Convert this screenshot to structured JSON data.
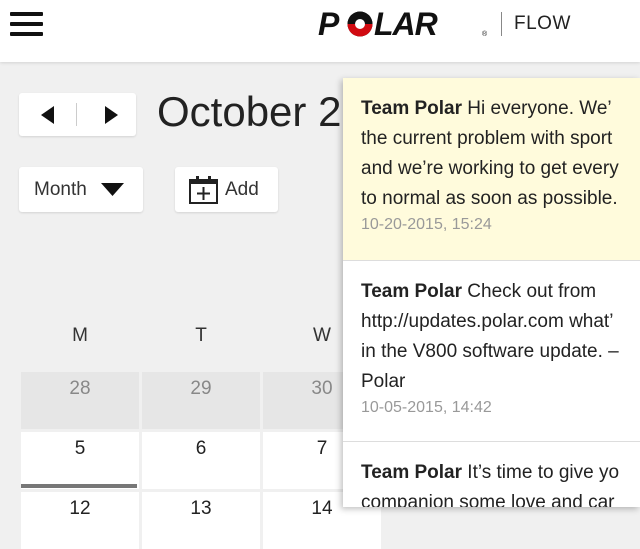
{
  "header": {
    "logo_text": "POLAR",
    "product": "FLOW"
  },
  "calendar": {
    "title": "October 2",
    "view_select": "Month",
    "add_label": "Add",
    "weekdays": [
      "M",
      "T",
      "W"
    ],
    "weeks": [
      [
        "28",
        "29",
        "30"
      ],
      [
        "5",
        "6",
        "7"
      ],
      [
        "12",
        "13",
        "14"
      ]
    ]
  },
  "notifications": [
    {
      "sender": "Team Polar",
      "lines": [
        " Hi everyone. We’",
        "the current problem with sport",
        "and we’re working to get every",
        "to normal as soon as possible."
      ],
      "time": "10-20-2015, 15:24",
      "unread": true
    },
    {
      "sender": "Team Polar",
      "lines": [
        " Check out from",
        "http://updates.polar.com what’",
        "in the V800 software update. –",
        "Polar"
      ],
      "time": "10-05-2015, 14:42",
      "unread": false
    },
    {
      "sender": "Team Polar",
      "lines": [
        " It’s time to give yo",
        "companion some love and car"
      ],
      "time": "",
      "unread": false
    }
  ],
  "colors": {
    "brand_red": "#d10a11",
    "unread_bg": "#fffbdc",
    "page_bg": "#f0f0f0"
  }
}
